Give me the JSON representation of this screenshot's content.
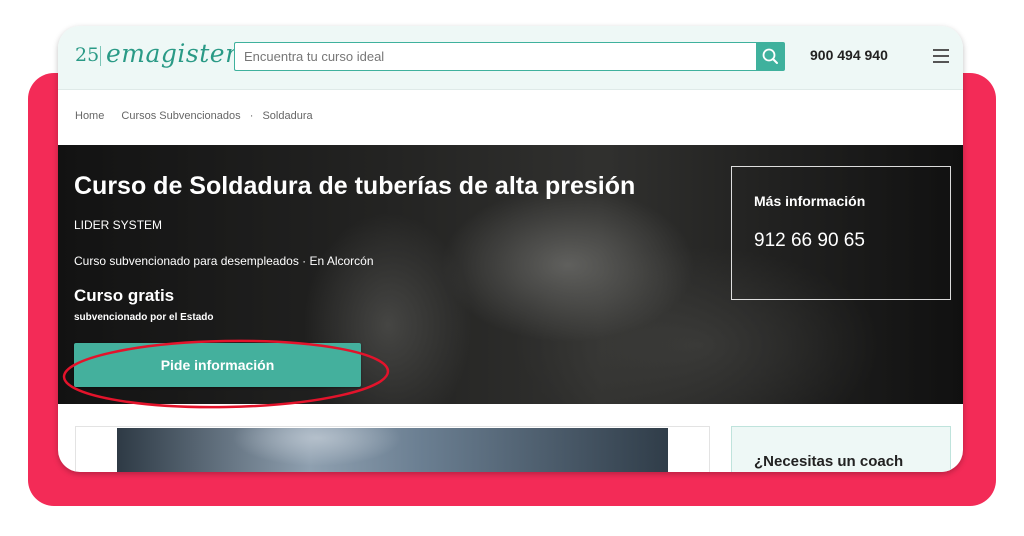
{
  "header": {
    "logo_number": "25",
    "logo_text": "emagister:",
    "search_placeholder": "Encuentra tu curso ideal",
    "phone": "900 494 940"
  },
  "breadcrumb": [
    "Home",
    "Cursos Subvencionados",
    "Soldadura"
  ],
  "course": {
    "title": "Curso de Soldadura de tuberías de alta presión",
    "provider": "LIDER SYSTEM",
    "meta": "Curso subvencionado para desempleados   · En Alcorcón",
    "price": "Curso gratis",
    "price_note": "subvencionado por el Estado",
    "cta_label": "Pide información"
  },
  "info_box": {
    "label": "Más información",
    "phone": "912 66 90 65"
  },
  "coach_box": {
    "label": "¿Necesitas un coach"
  },
  "colors": {
    "brand_teal": "#44b09d",
    "highlight_pink": "#f32b57",
    "annotation_red": "#e3132b"
  },
  "icons": [
    "search-icon",
    "menu-icon"
  ]
}
